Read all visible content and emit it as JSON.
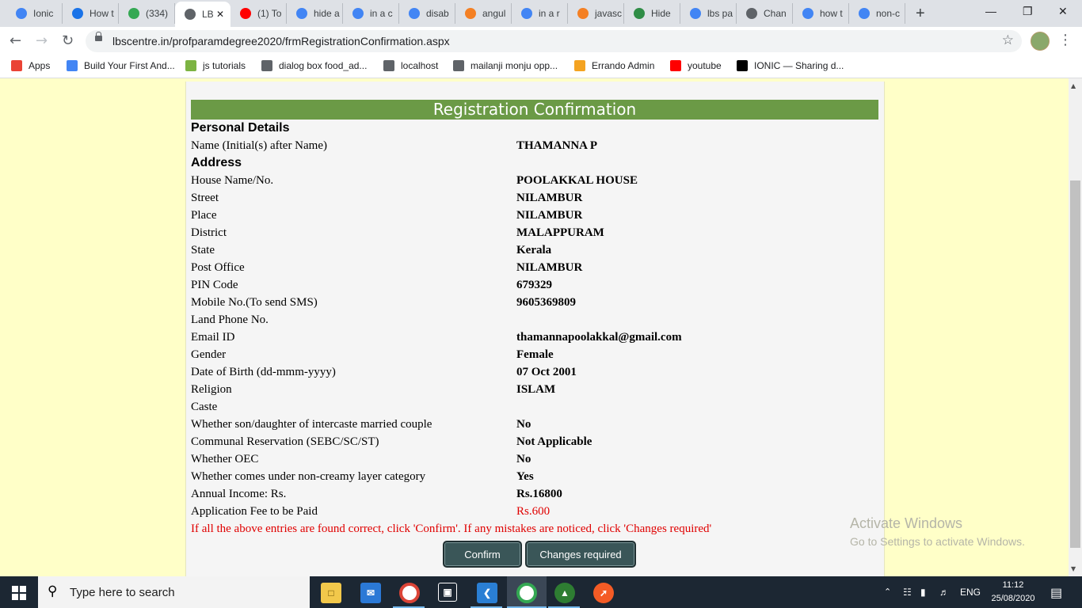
{
  "browser": {
    "tabs": [
      {
        "title": "Ionic",
        "color": "#4285f4"
      },
      {
        "title": "How t",
        "color": "#1a73e8"
      },
      {
        "title": "(334)",
        "color": "#34a853"
      },
      {
        "title": "LB",
        "color": "#5f6368",
        "active": true
      },
      {
        "title": "(1) To",
        "color": "#ff0000"
      },
      {
        "title": "hide a",
        "color": "#4285f4"
      },
      {
        "title": "in a c",
        "color": "#4285f4"
      },
      {
        "title": "disab",
        "color": "#4285f4"
      },
      {
        "title": "angul",
        "color": "#f48024"
      },
      {
        "title": "in a r",
        "color": "#4285f4"
      },
      {
        "title": "javasc",
        "color": "#f48024"
      },
      {
        "title": "Hide",
        "color": "#2f8d46"
      },
      {
        "title": "lbs pa",
        "color": "#4285f4"
      },
      {
        "title": "Chan",
        "color": "#5f6368"
      },
      {
        "title": "how t",
        "color": "#4285f4"
      },
      {
        "title": "non-c",
        "color": "#4285f4"
      }
    ],
    "url": "lbscentre.in/profparamdegree2020/frmRegistrationConfirmation.aspx",
    "bookmarks": [
      {
        "label": "Apps",
        "color": "#ea4335"
      },
      {
        "label": "Build Your First And...",
        "color": "#4285f4"
      },
      {
        "label": "js tutorials",
        "color": "#7cb342"
      },
      {
        "label": "dialog box food_ad...",
        "color": "#5f6368"
      },
      {
        "label": "localhost",
        "color": "#5f6368"
      },
      {
        "label": "mailanji monju opp...",
        "color": "#5f6368"
      },
      {
        "label": "Errando Admin",
        "color": "#f4a321"
      },
      {
        "label": "youtube",
        "color": "#ff0000"
      },
      {
        "label": "IONIC — Sharing d...",
        "color": "#000000"
      }
    ]
  },
  "page": {
    "header": "Registration Confirmation",
    "personal_section": "Personal Details",
    "address_section": "Address",
    "fields": [
      {
        "label": "Name (Initial(s) after Name)",
        "value": "THAMANNA P"
      },
      {
        "label": "House Name/No.",
        "value": "POOLAKKAL HOUSE"
      },
      {
        "label": "Street",
        "value": "NILAMBUR"
      },
      {
        "label": "Place",
        "value": "NILAMBUR"
      },
      {
        "label": "District",
        "value": "MALAPPURAM"
      },
      {
        "label": "State",
        "value": "Kerala"
      },
      {
        "label": "Post Office",
        "value": "NILAMBUR"
      },
      {
        "label": "PIN Code",
        "value": "679329"
      },
      {
        "label": "Mobile No.(To send SMS)",
        "value": "9605369809"
      },
      {
        "label": "Land Phone No.",
        "value": ""
      },
      {
        "label": "Email ID",
        "value": "thamannapoolakkal@gmail.com"
      },
      {
        "label": "Gender",
        "value": "Female"
      },
      {
        "label": "Date of Birth (dd-mmm-yyyy)",
        "value": "07 Oct 2001"
      },
      {
        "label": "Religion",
        "value": "ISLAM"
      },
      {
        "label": "Caste",
        "value": ""
      },
      {
        "label": "Whether son/daughter of intercaste married couple",
        "value": "No"
      },
      {
        "label": "Communal Reservation (SEBC/SC/ST)",
        "value": "Not Applicable"
      },
      {
        "label": "Whether OEC",
        "value": "No"
      },
      {
        "label": "Whether comes under non-creamy layer category",
        "value": "Yes"
      },
      {
        "label": "Annual Income: Rs.",
        "value": "Rs.16800"
      },
      {
        "label": "Application Fee to be Paid",
        "value": "Rs.600"
      }
    ],
    "note": "If all the above entries are found correct, click 'Confirm'. If any mistakes are noticed, click 'Changes required'",
    "confirm_label": "Confirm",
    "changes_label": "Changes required",
    "colors": {
      "header_bg": "#6b9a46",
      "page_bg": "#ffffc8",
      "button_bg": "#3a5658",
      "alert": "#e00000"
    }
  },
  "watermark": {
    "line1": "Activate Windows",
    "line2": "Go to Settings to activate Windows."
  },
  "taskbar": {
    "search_placeholder": "Type here to search",
    "language": "ENG",
    "time": "11:12",
    "date": "25/08/2020"
  }
}
